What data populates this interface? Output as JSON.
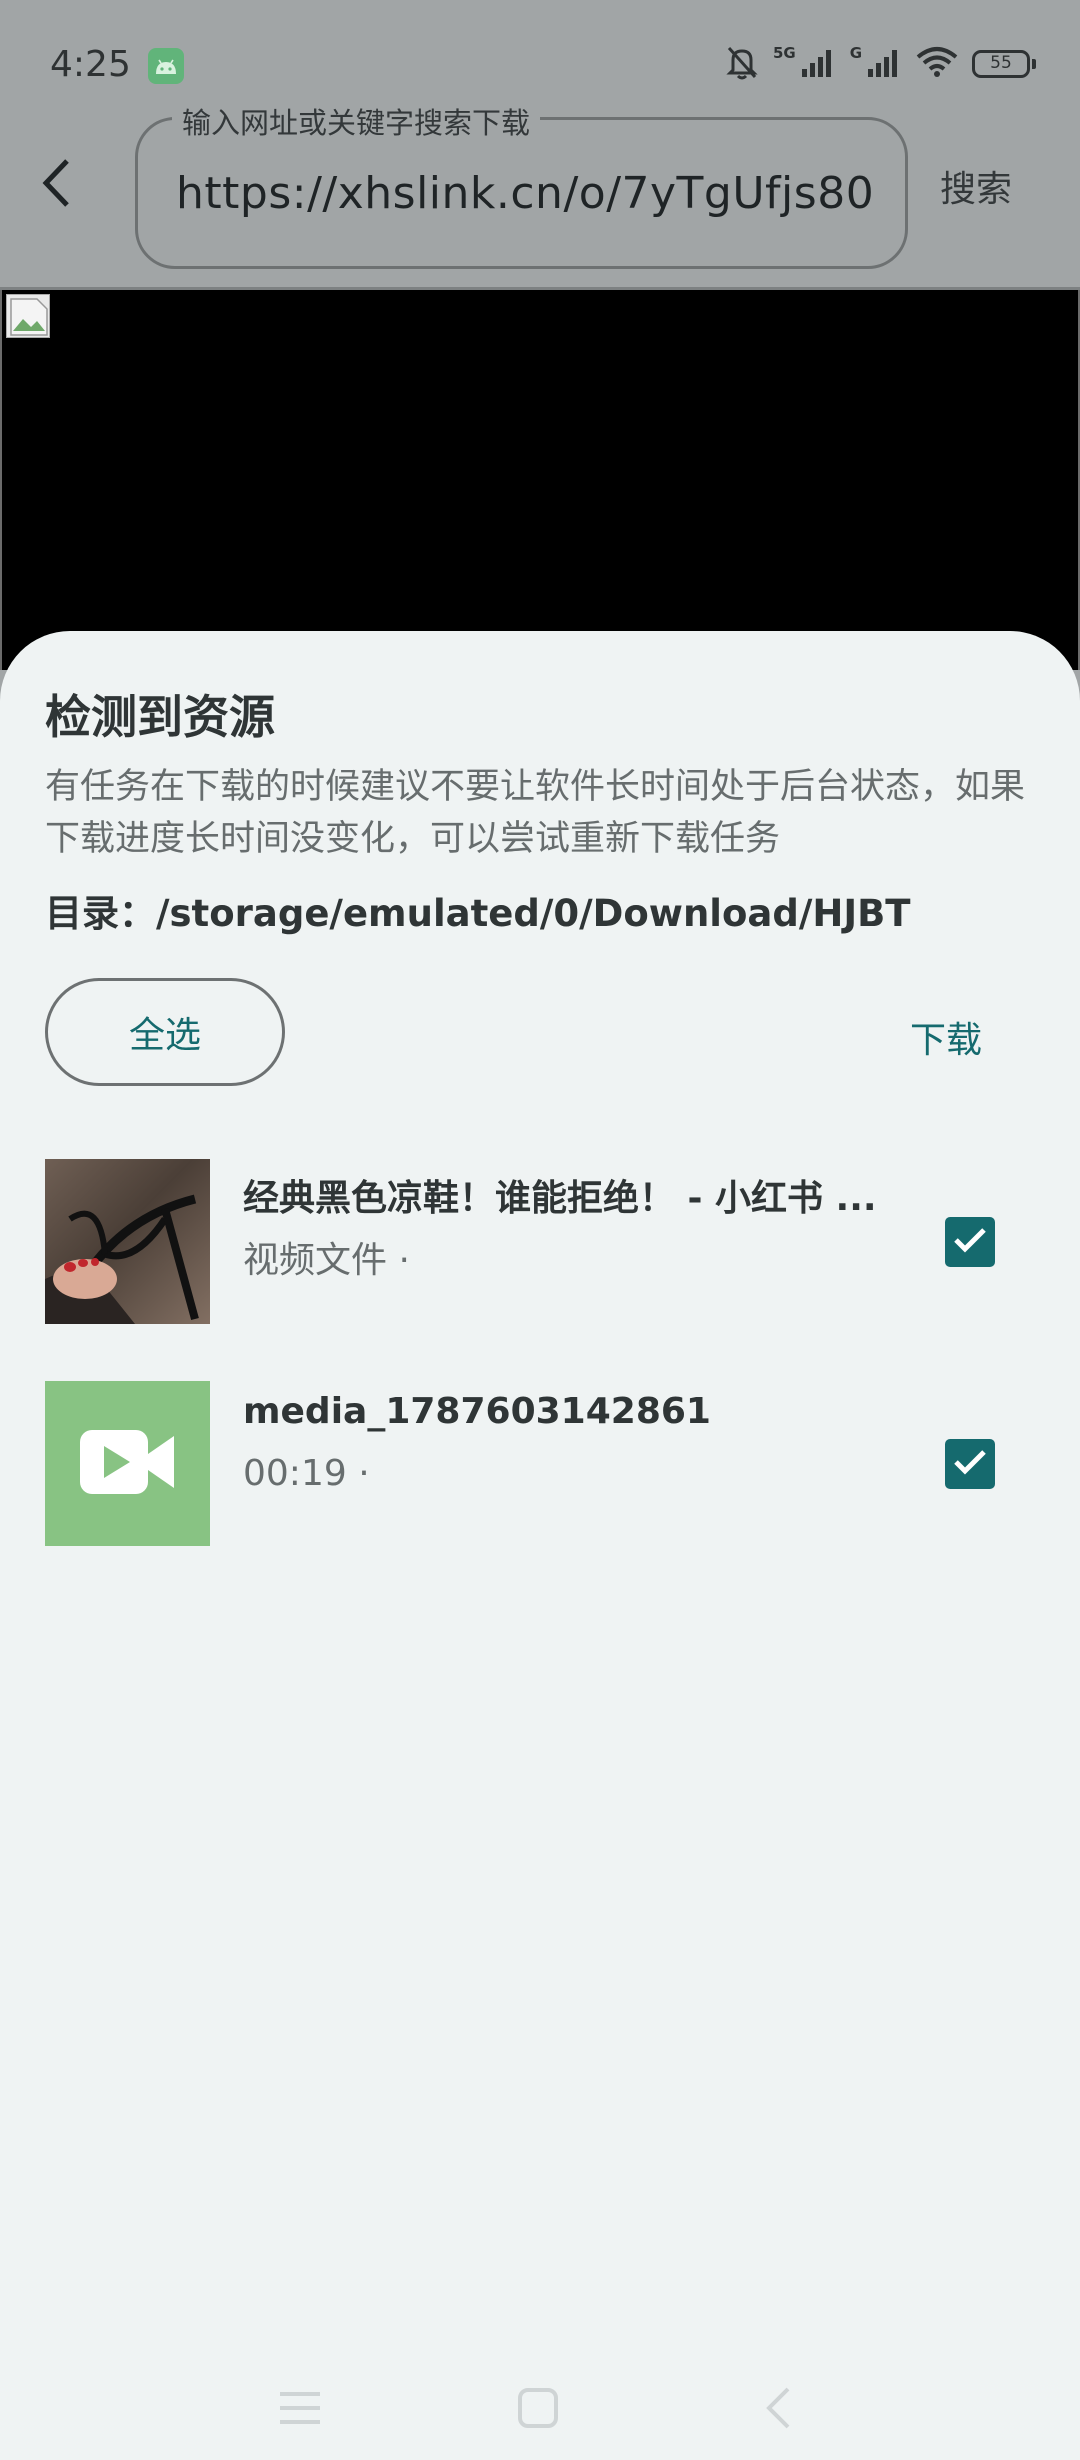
{
  "status_bar": {
    "time": "4:25",
    "network_1": "5G",
    "network_2": "G",
    "battery": "55",
    "icons": [
      "android-icon",
      "mute-bell-icon",
      "signal-icon",
      "signal-icon",
      "wifi-icon",
      "battery-icon"
    ]
  },
  "top_bar": {
    "field_label": "输入网址或关键字搜索下载",
    "url_value": "https://xhslink.cn/o/7yTgUfjs80",
    "search_label": "搜索"
  },
  "sheet": {
    "title": "检测到资源",
    "description": "有任务在下载的时候建议不要让软件长时间处于后台状态，如果下载进度长时间没变化，可以尝试重新下载任务",
    "directory": "目录：/storage/emulated/0/Download/HJBT",
    "select_all_label": "全选",
    "download_label": "下载",
    "items": [
      {
        "title": "经典黑色凉鞋！谁能拒绝！ - 小红书 ...",
        "subtitle": "视频文件 ·",
        "checked": true
      },
      {
        "title": "media_1787603142861",
        "subtitle": "00:19 ·",
        "checked": true
      }
    ]
  },
  "colors": {
    "accent": "#156a6e",
    "sheet_background": "#eff3f3",
    "scrim": "#a1a5a6",
    "video_thumb": "#88c383"
  }
}
